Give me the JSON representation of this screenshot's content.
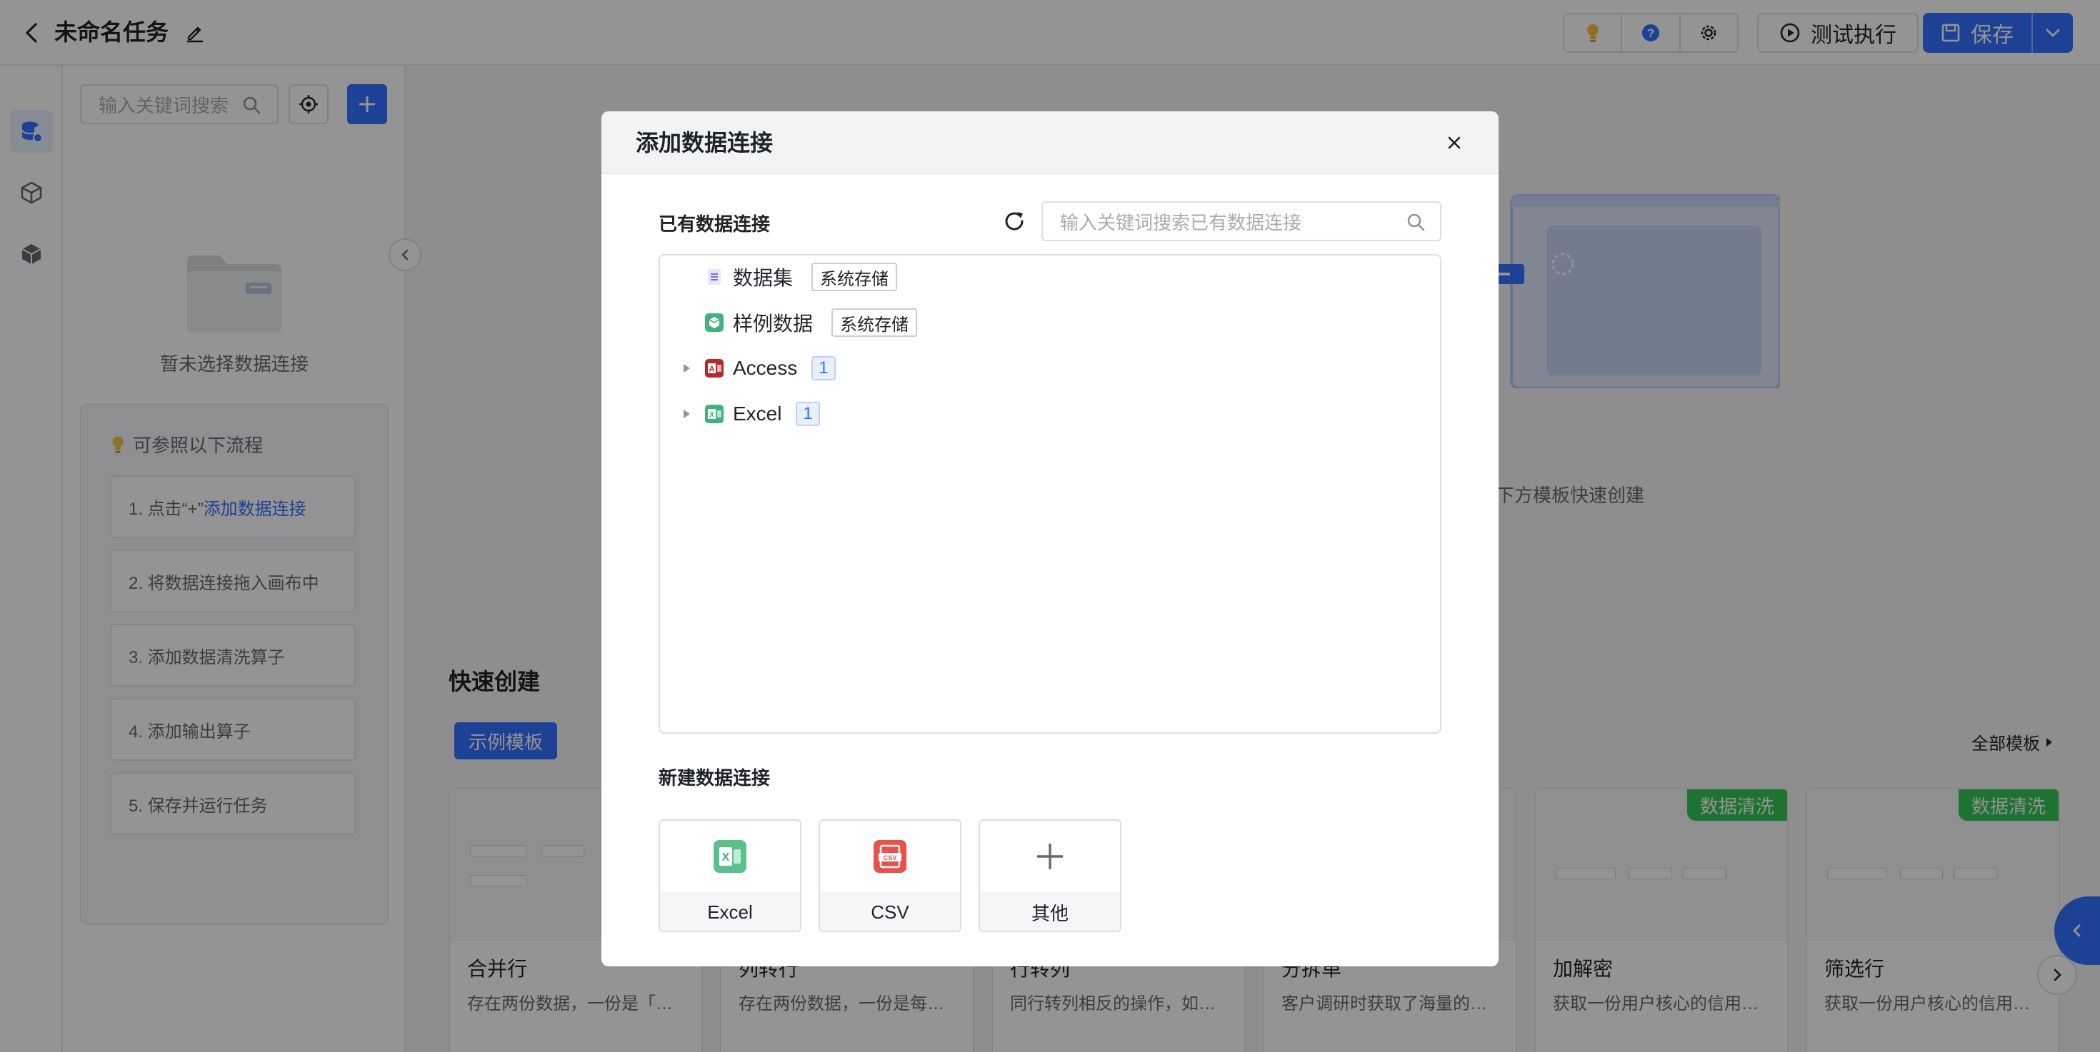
{
  "header": {
    "title": "未命名任务",
    "run_label": "测试执行",
    "save_label": "保存"
  },
  "left_panel": {
    "search_placeholder": "输入关键词搜索",
    "empty_text": "暂未选择数据连接",
    "flow_title": "可参照以下流程",
    "steps": [
      {
        "prefix": "1. 点击“+”",
        "link": "添加数据连接"
      },
      {
        "text": "2. 将数据连接拖入画布中"
      },
      {
        "text": "3. 添加数据清洗算子"
      },
      {
        "text": "4. 添加输出算子"
      },
      {
        "text": "5. 保存并运行任务"
      }
    ]
  },
  "main": {
    "canvas_hint": "下方模板快速创建",
    "quick_title": "快速创建",
    "template_tab": "示例模板",
    "all_templates": "全部模板",
    "cards": [
      {
        "title": "合并行",
        "desc": "存在两份数据，一份是「…",
        "tag": ""
      },
      {
        "title": "列转行",
        "desc": "存在两份数据，一份是每…",
        "tag": ""
      },
      {
        "title": "行转列",
        "desc": "同行转列相反的操作，如…",
        "tag": ""
      },
      {
        "title": "分拆单",
        "desc": "客户调研时获取了海量的…",
        "tag": ""
      },
      {
        "title": "加解密",
        "desc": "获取一份用户核心的信用…",
        "tag": "数据清洗"
      },
      {
        "title": "筛选行",
        "desc": "获取一份用户核心的信用…",
        "tag": "数据清洗"
      }
    ]
  },
  "modal": {
    "title": "添加数据连接",
    "existing_label": "已有数据连接",
    "search_placeholder": "输入关键词搜索已有数据连接",
    "tree": [
      {
        "label": "数据集",
        "tag": "系统存储",
        "icon": "dataset-icon",
        "expandable": false
      },
      {
        "label": "样例数据",
        "tag": "系统存储",
        "icon": "sample-data-icon",
        "expandable": false
      },
      {
        "label": "Access",
        "count": "1",
        "icon": "access-icon",
        "expandable": true
      },
      {
        "label": "Excel",
        "count": "1",
        "icon": "excel-icon",
        "expandable": true
      }
    ],
    "new_label": "新建数据连接",
    "new_options": [
      {
        "label": "Excel",
        "icon": "excel-file-icon"
      },
      {
        "label": "CSV",
        "icon": "csv-file-icon"
      },
      {
        "label": "其他",
        "icon": "plus-icon"
      }
    ]
  },
  "colors": {
    "primary": "#3370ff",
    "tag_green": "#34c759",
    "excel_green": "#3fb27f",
    "access_red": "#b7282e",
    "csv_red": "#e5534b"
  }
}
